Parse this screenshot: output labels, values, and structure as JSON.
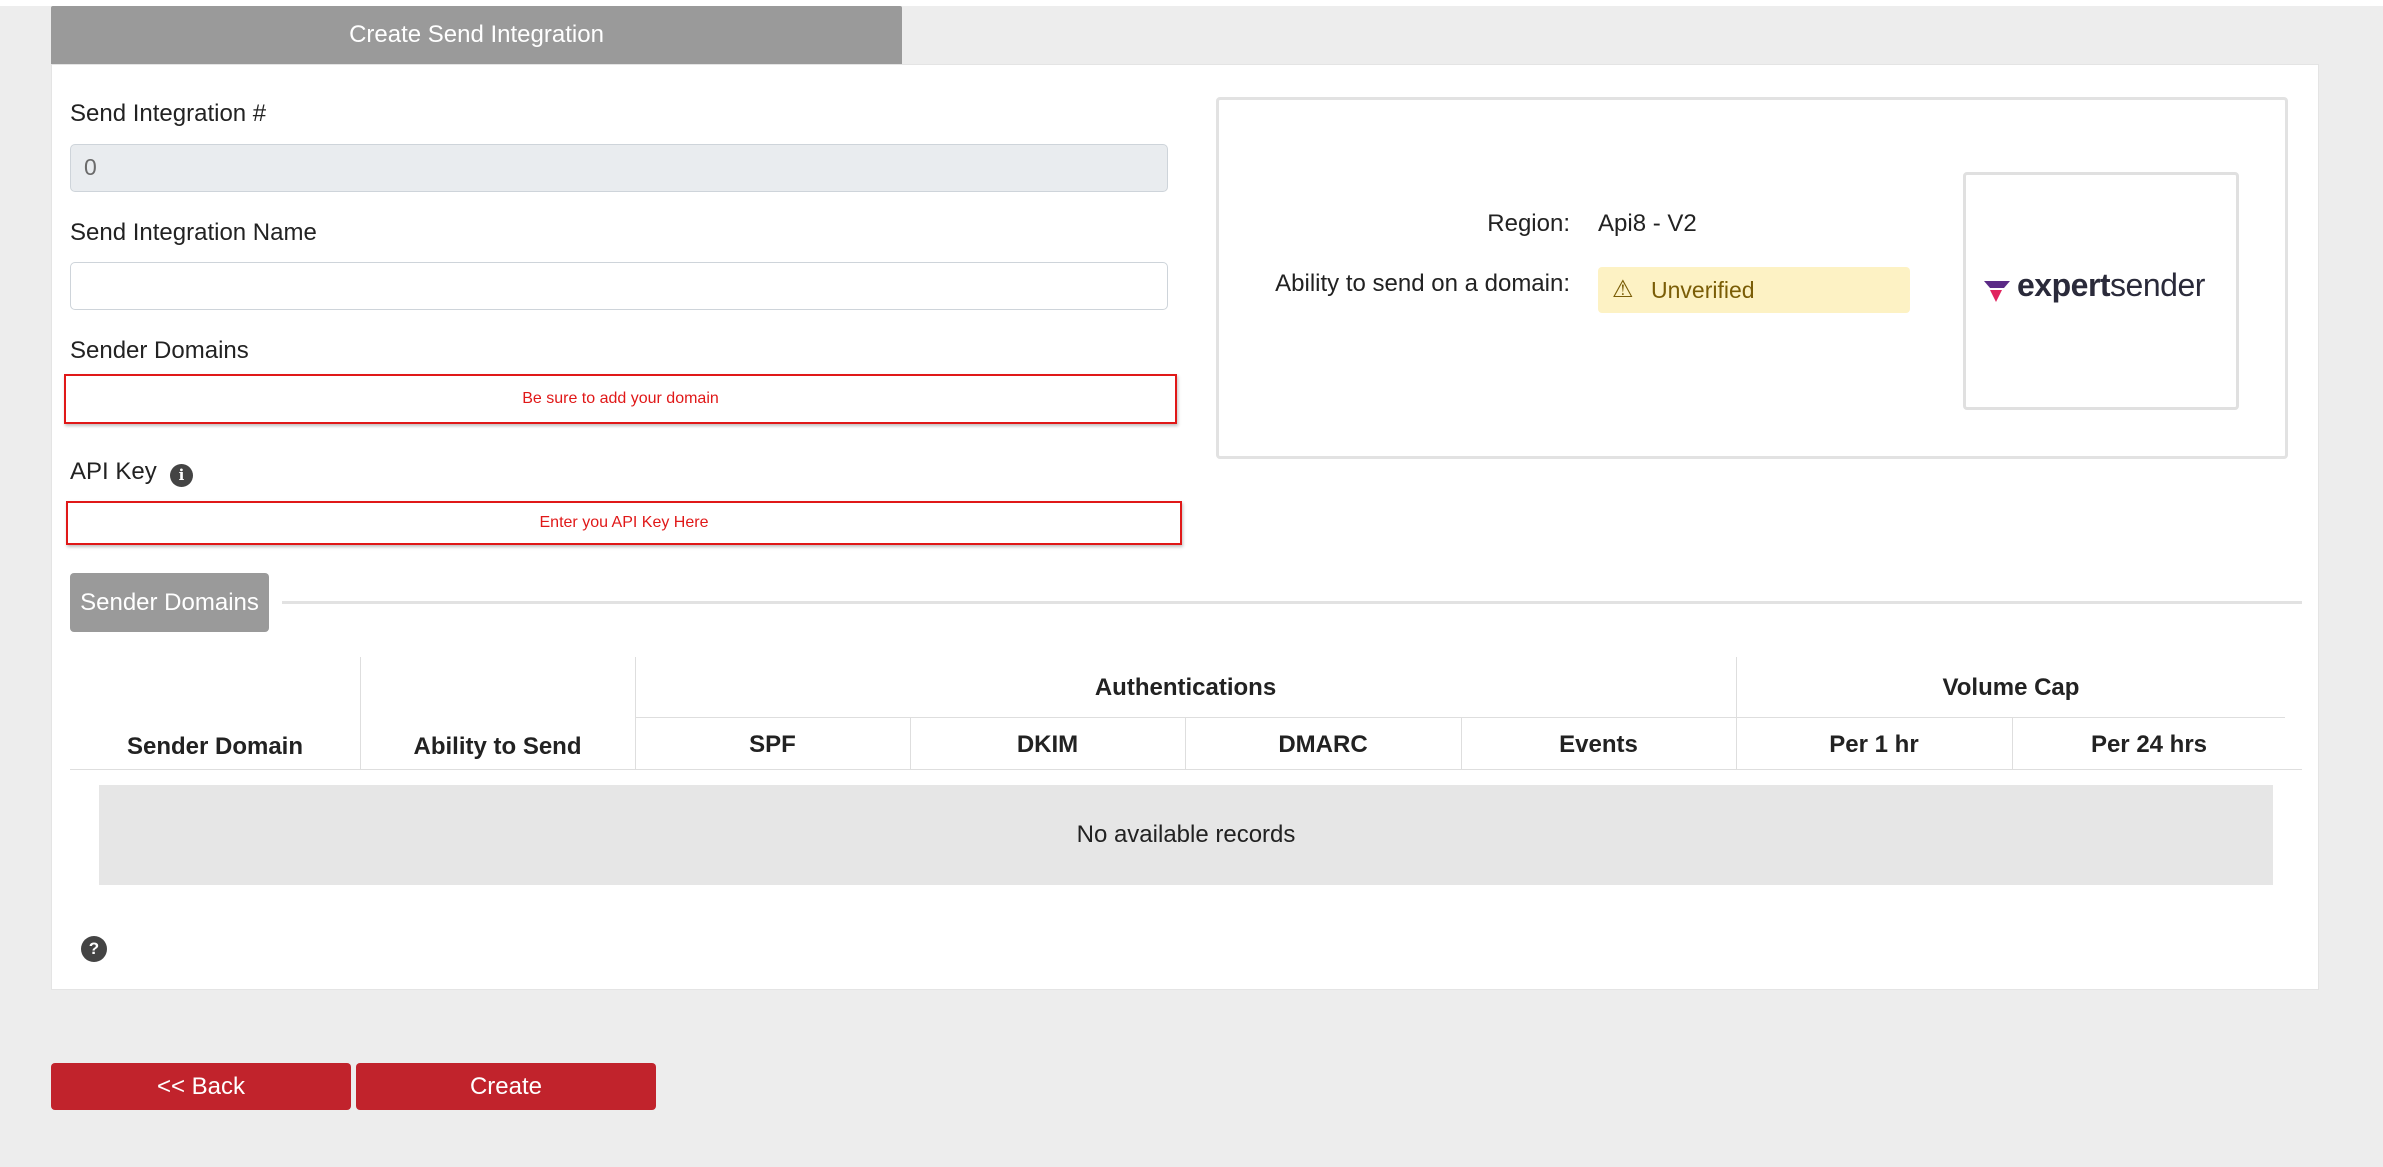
{
  "header": {
    "title": "Create Send Integration"
  },
  "form": {
    "integration_number": {
      "label": "Send Integration #",
      "value": "0"
    },
    "integration_name": {
      "label": "Send Integration Name",
      "value": ""
    },
    "sender_domains": {
      "label": "Sender Domains",
      "error": "Be sure to add your domain"
    },
    "api_key": {
      "label": "API Key",
      "error": "Enter you API Key Here"
    }
  },
  "info_card": {
    "region_label": "Region:",
    "region_value": "Api8 - V2",
    "ability_label": "Ability to send on a domain:",
    "ability_status": "Unverified",
    "logo": {
      "name": "expertsender",
      "prefix": "expert",
      "suffix": "sender"
    }
  },
  "section": {
    "label": "Sender Domains"
  },
  "table": {
    "columns": {
      "sender_domain": "Sender Domain",
      "ability_to_send": "Ability to Send",
      "authentications": "Authentications",
      "spf": "SPF",
      "dkim": "DKIM",
      "dmarc": "DMARC",
      "events": "Events",
      "volume_cap": "Volume Cap",
      "per_1hr": "Per 1 hr",
      "per_24hrs": "Per 24 hrs"
    },
    "empty_message": "No available records"
  },
  "buttons": {
    "back": "<< Back",
    "create": "Create"
  },
  "colors": {
    "accent": "#c1232c",
    "tab": "#9a9a9a",
    "error": "#e01818",
    "warning_bg": "#fdf2c4"
  },
  "icons": {
    "info": "info-icon",
    "warning": "warning-icon",
    "help": "question-icon"
  }
}
